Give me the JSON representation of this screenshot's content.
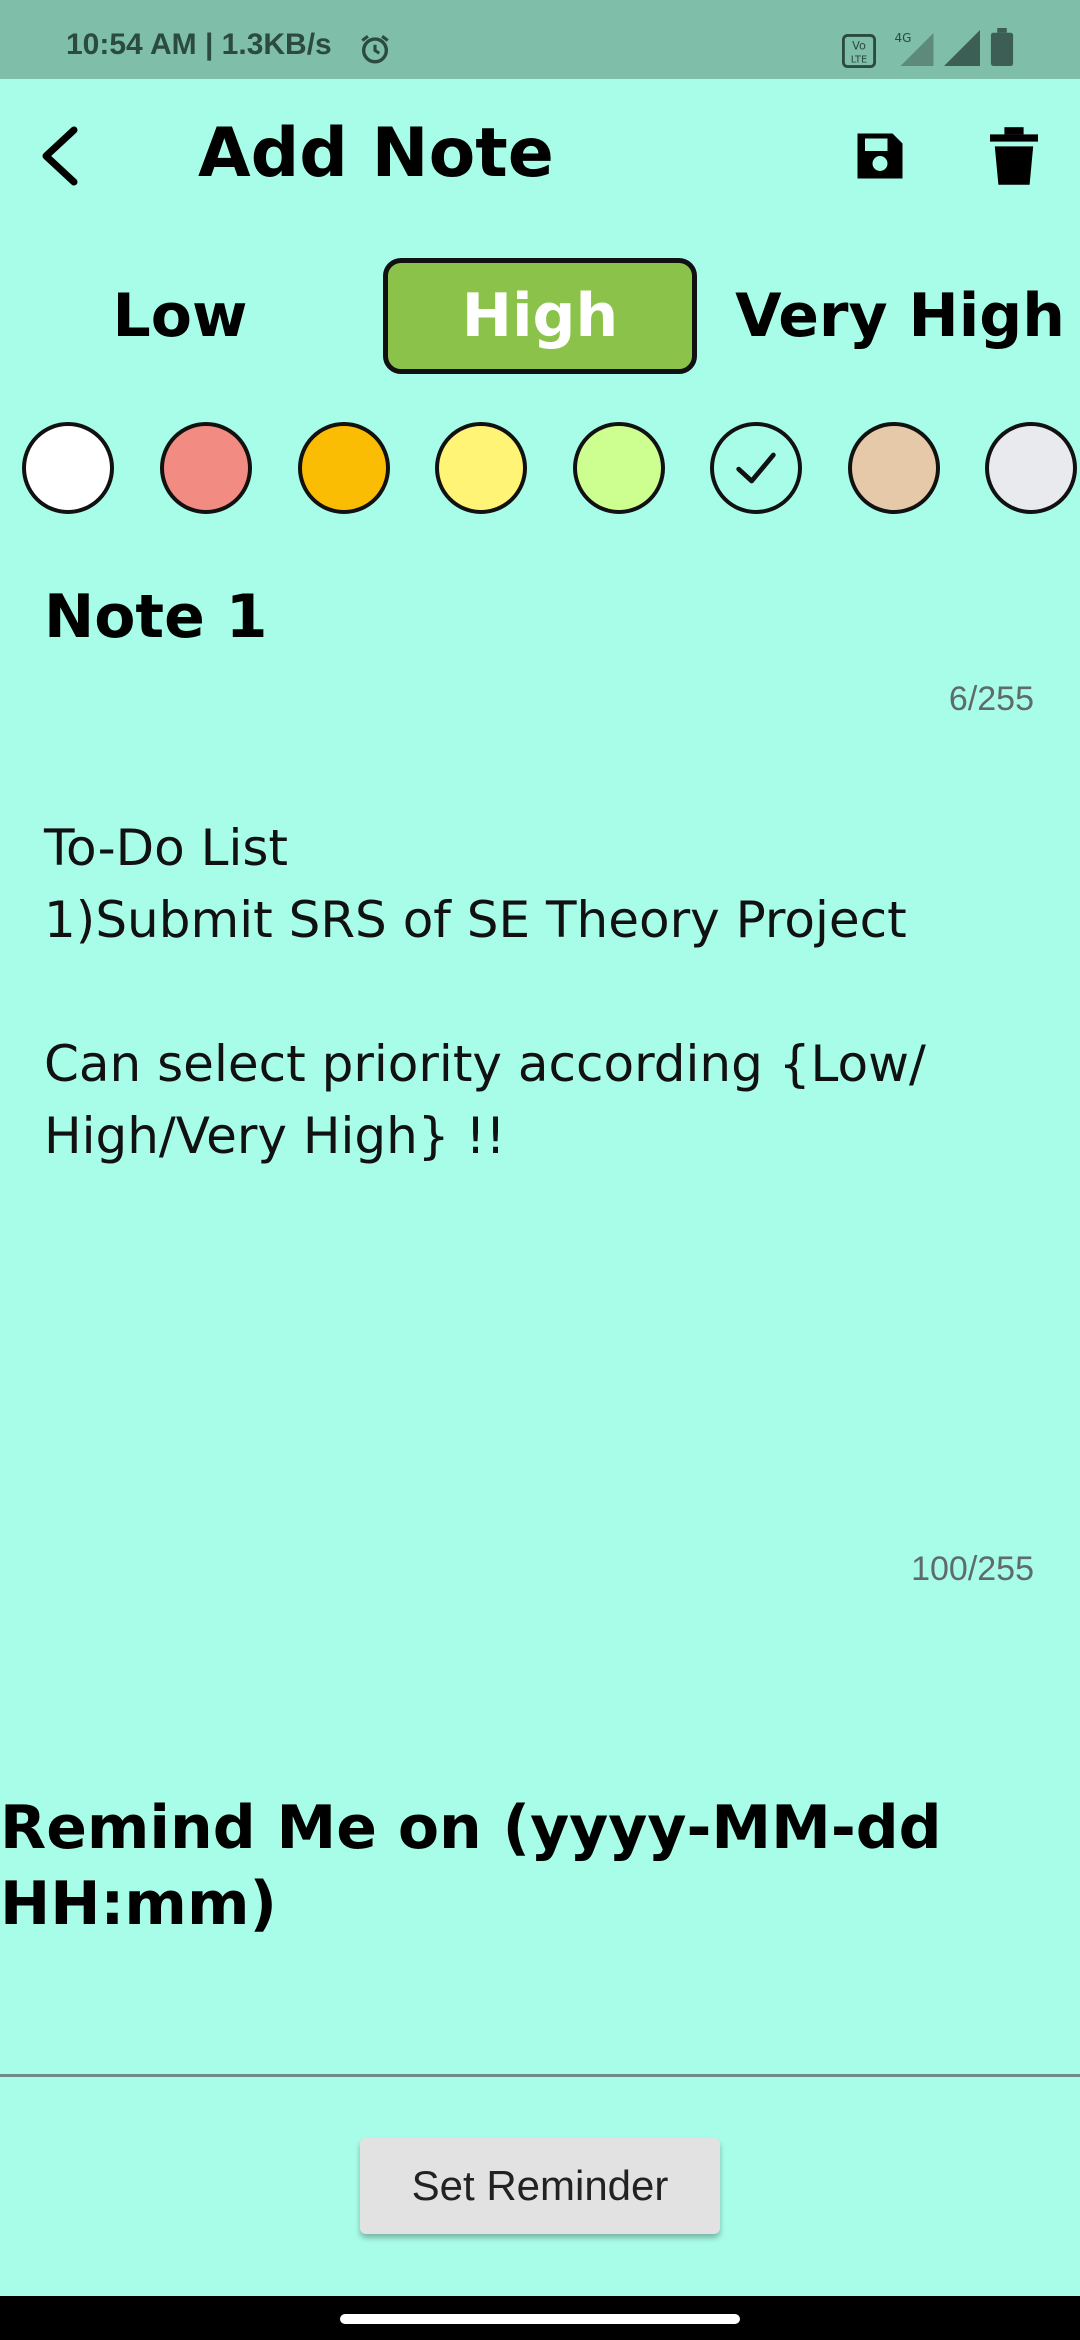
{
  "status_bar": {
    "text": "10:54 AM | 1.3KB/s",
    "icons": [
      "alarm-icon",
      "volte-icon",
      "signal-4g-icon",
      "signal-icon",
      "battery-icon"
    ]
  },
  "toolbar": {
    "title": "Add Note",
    "icons": [
      "back-icon",
      "save-icon",
      "delete-icon"
    ]
  },
  "priority": {
    "options": [
      "Low",
      "High",
      "Very High"
    ],
    "selected": "High",
    "selected_color": "#8bc34a"
  },
  "colors": {
    "swatches": [
      "#ffffff",
      "#f28b82",
      "#fbbc04",
      "#fff475",
      "#ccff90",
      "#a8fde9",
      "#e6c9a8",
      "#e8eaed"
    ],
    "selected_index": 5
  },
  "note": {
    "title": "Note 1",
    "title_counter": "6/255",
    "body_lines": [
      "To-Do List",
      "1)Submit SRS of SE Theory Project",
      "",
      "Can select priority according {Low/",
      "High/Very High} !!"
    ],
    "body_counter": "100/255"
  },
  "reminder": {
    "label_lines": [
      "Remind Me on (yyyy-MM-dd",
      "HH:mm)"
    ],
    "button_label": "Set Reminder"
  }
}
